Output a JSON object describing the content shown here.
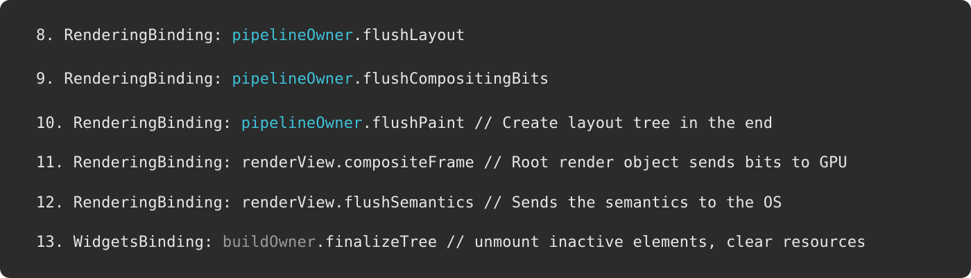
{
  "colors": {
    "background": "#2b2b2b",
    "text": "#e6e6e6",
    "accent": "#3fc1d9",
    "dim": "#9a9a9a"
  },
  "lines": [
    {
      "prefix": "8. RenderingBinding: ",
      "object": "pipelineOwner",
      "object_style": "accent",
      "suffix": ".flushLayout"
    },
    {
      "prefix": "9. RenderingBinding: ",
      "object": "pipelineOwner",
      "object_style": "accent",
      "suffix": ".flushCompositingBits"
    },
    {
      "prefix": "10. RenderingBinding: ",
      "object": "pipelineOwner",
      "object_style": "accent",
      "suffix": ".flushPaint // Create layout tree in the end"
    },
    {
      "prefix": "11. RenderingBinding: ",
      "object": "renderView",
      "object_style": "plain",
      "suffix": ".compositeFrame // Root render object sends bits to GPU"
    },
    {
      "prefix": "12. RenderingBinding: ",
      "object": "renderView",
      "object_style": "plain",
      "suffix": ".flushSemantics // Sends the semantics to the OS"
    },
    {
      "prefix": "13. WidgetsBinding: ",
      "object": "buildOwner",
      "object_style": "dim",
      "suffix": ".finalizeTree // unmount inactive elements, clear resources"
    }
  ]
}
